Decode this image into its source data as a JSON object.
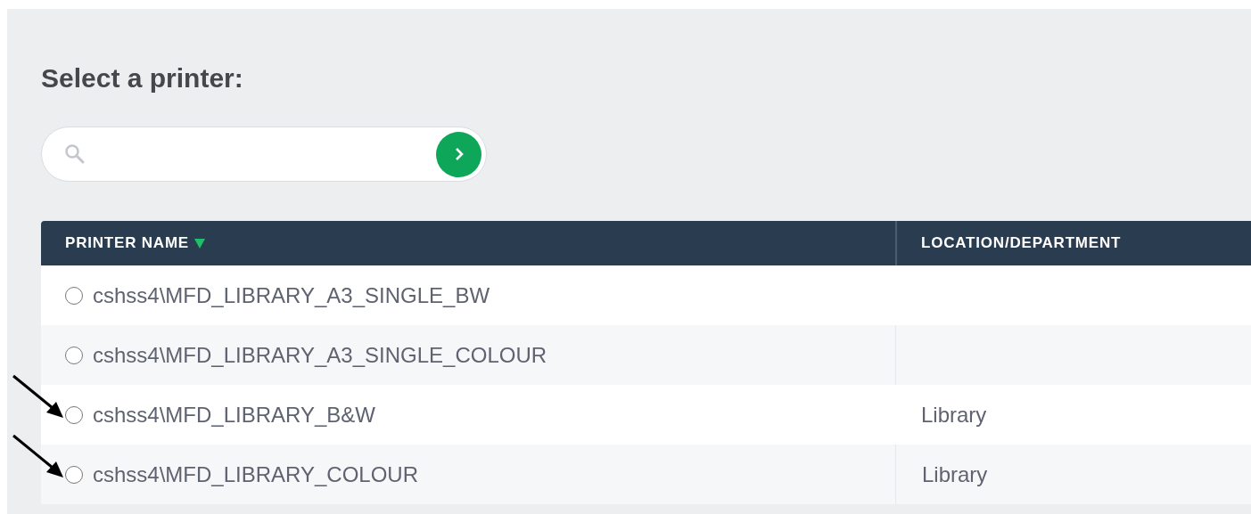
{
  "title": "Select a printer:",
  "table": {
    "columns": [
      {
        "label": "PRINTER NAME",
        "sorted": true
      },
      {
        "label": "LOCATION/DEPARTMENT",
        "sorted": false
      }
    ],
    "rows": [
      {
        "name": "cshss4\\MFD_LIBRARY_A3_SINGLE_BW",
        "selected": false,
        "pointed": false
      },
      {
        "name": "cshss4\\MFD_LIBRARY_A3_SINGLE_COLOUR",
        "selected": false,
        "pointed": false
      },
      {
        "name": "cshss4\\MFD_LIBRARY_B&W",
        "location": "Library",
        "selected": false,
        "pointed": true
      },
      {
        "name": "cshss4\\MFD_LIBRARY_COLOUR",
        "location": "Library",
        "selected": false,
        "pointed": true
      }
    ]
  }
}
